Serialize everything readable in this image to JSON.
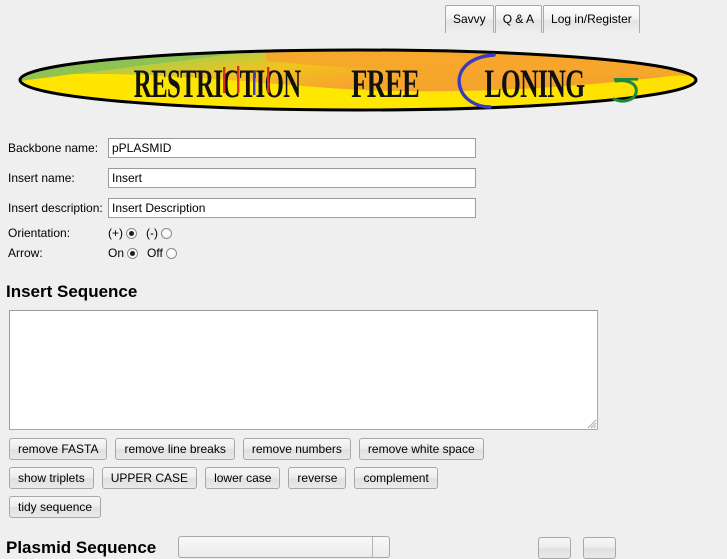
{
  "nav": {
    "items": [
      {
        "label": "Savvy",
        "name": "nav-savvy"
      },
      {
        "label": "Q & A",
        "name": "nav-qa"
      },
      {
        "label": "Log in/Register",
        "name": "nav-login-register"
      }
    ]
  },
  "logo": {
    "text": "RESTRICTION FREE CLONING",
    "word1": "RESTRICTION",
    "word2": "FREE",
    "word3": "CLONING",
    "colors": {
      "green": "#7cb342",
      "yellow": "#ffe800",
      "orange": "#f5a62e",
      "outline": "#000000",
      "accent_red": "#d93025",
      "accent_blue": "#3b3bbf",
      "accent_green": "#1a8a3c"
    }
  },
  "form": {
    "fields": [
      {
        "label": "Backbone name:",
        "value": "pPLASMID",
        "name": "backbone-name"
      },
      {
        "label": "Insert name:",
        "value": "Insert",
        "name": "insert-name"
      },
      {
        "label": "Insert description:",
        "value": "Insert Description",
        "name": "insert-description"
      }
    ],
    "orientation": {
      "label": "Orientation:",
      "option_plus": "(+)",
      "option_minus": "(-)",
      "selected": "(+)"
    },
    "arrow": {
      "label": "Arrow:",
      "option_on": "On",
      "option_off": "Off",
      "selected": "On"
    }
  },
  "insert_sequence": {
    "title": "Insert Sequence",
    "value": "",
    "placeholder": ""
  },
  "tool_buttons": {
    "row1": [
      {
        "label": "remove FASTA",
        "name": "remove-fasta-button"
      },
      {
        "label": "remove line breaks",
        "name": "remove-line-breaks-button"
      },
      {
        "label": "remove numbers",
        "name": "remove-numbers-button"
      },
      {
        "label": "remove white space",
        "name": "remove-white-space-button"
      }
    ],
    "row2": [
      {
        "label": "show triplets",
        "name": "show-triplets-button"
      },
      {
        "label": "UPPER CASE",
        "name": "upper-case-button"
      },
      {
        "label": "lower case",
        "name": "lower-case-button"
      },
      {
        "label": "reverse",
        "name": "reverse-button"
      },
      {
        "label": "complement",
        "name": "complement-button"
      }
    ],
    "row3": [
      {
        "label": "tidy sequence",
        "name": "tidy-sequence-button"
      }
    ]
  },
  "plasmid_section": {
    "title": "Plasmid Sequence",
    "select_value": "",
    "button1": "",
    "button2": ""
  },
  "colors": {
    "page_background": "#efefef",
    "input_background": "#ffffff",
    "border": "#a0a0a0"
  }
}
